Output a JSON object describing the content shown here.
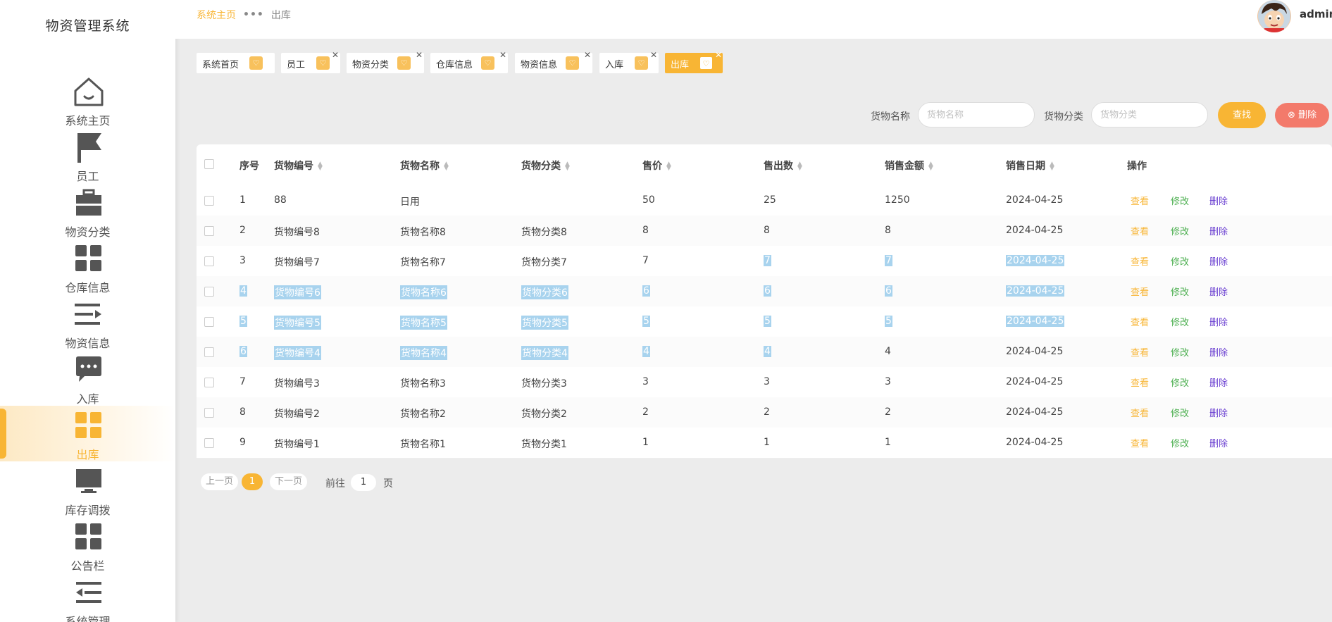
{
  "app": {
    "title": "物资管理系统"
  },
  "sidebar": {
    "items": [
      {
        "label": "系统主页",
        "icon": "home-icon"
      },
      {
        "label": "员工",
        "icon": "flag-icon"
      },
      {
        "label": "物资分类",
        "icon": "briefcase-icon"
      },
      {
        "label": "仓库信息",
        "icon": "grid-icon"
      },
      {
        "label": "物资信息",
        "icon": "list-arrow-icon"
      },
      {
        "label": "入库",
        "icon": "chat-icon"
      },
      {
        "label": "出库",
        "icon": "grid-icon",
        "active": true
      },
      {
        "label": "库存调拨",
        "icon": "monitor-icon"
      },
      {
        "label": "公告栏",
        "icon": "grid-icon"
      },
      {
        "label": "系统管理",
        "icon": "menu-fold-icon"
      }
    ]
  },
  "header": {
    "breadcrumb_home": "系统主页",
    "breadcrumb_sep": "•••",
    "breadcrumb_current": "出库",
    "username": "admin"
  },
  "tags": [
    {
      "label": "系统首页"
    },
    {
      "label": "员工"
    },
    {
      "label": "物资分类"
    },
    {
      "label": "仓库信息"
    },
    {
      "label": "物资信息"
    },
    {
      "label": "入库"
    },
    {
      "label": "出库",
      "active": true
    }
  ],
  "search": {
    "name_label": "货物名称",
    "name_placeholder": "货物名称",
    "category_label": "货物分类",
    "category_placeholder": "货物分类",
    "find_button": "查找",
    "delete_button": "删除"
  },
  "table": {
    "columns": [
      "序号",
      "货物编号",
      "货物名称",
      "货物分类",
      "售价",
      "售出数",
      "销售金额",
      "销售日期",
      "操作"
    ],
    "actions": {
      "view": "查看",
      "edit": "修改",
      "delete": "删除"
    },
    "rows": [
      [
        "1",
        "88",
        "日用",
        "",
        "50",
        "25",
        "1250",
        "2024-04-25"
      ],
      [
        "2",
        "货物编号8",
        "货物名称8",
        "货物分类8",
        "8",
        "8",
        "8",
        "2024-04-25"
      ],
      [
        "3",
        "货物编号7",
        "货物名称7",
        "货物分类7",
        "7",
        "7",
        "7",
        "2024-04-25"
      ],
      [
        "4",
        "货物编号6",
        "货物名称6",
        "货物分类6",
        "6",
        "6",
        "6",
        "2024-04-25"
      ],
      [
        "5",
        "货物编号5",
        "货物名称5",
        "货物分类5",
        "5",
        "5",
        "5",
        "2024-04-25"
      ],
      [
        "6",
        "货物编号4",
        "货物名称4",
        "货物分类4",
        "4",
        "4",
        "4",
        "2024-04-25"
      ],
      [
        "7",
        "货物编号3",
        "货物名称3",
        "货物分类3",
        "3",
        "3",
        "3",
        "2024-04-25"
      ],
      [
        "8",
        "货物编号2",
        "货物名称2",
        "货物分类2",
        "2",
        "2",
        "2",
        "2024-04-25"
      ],
      [
        "9",
        "货物编号1",
        "货物名称1",
        "货物分类1",
        "1",
        "1",
        "1",
        "2024-04-25"
      ]
    ]
  },
  "pagination": {
    "prev": "上一页",
    "current": "1",
    "next": "下一页",
    "goto_label": "前往",
    "goto_value": "1",
    "page_unit": "页"
  },
  "colors": {
    "accent": "#f8b534",
    "danger": "#f37a6b",
    "edit": "#4caf50",
    "delete_link": "#6a3fd1",
    "selection": "#a8d3ee"
  }
}
